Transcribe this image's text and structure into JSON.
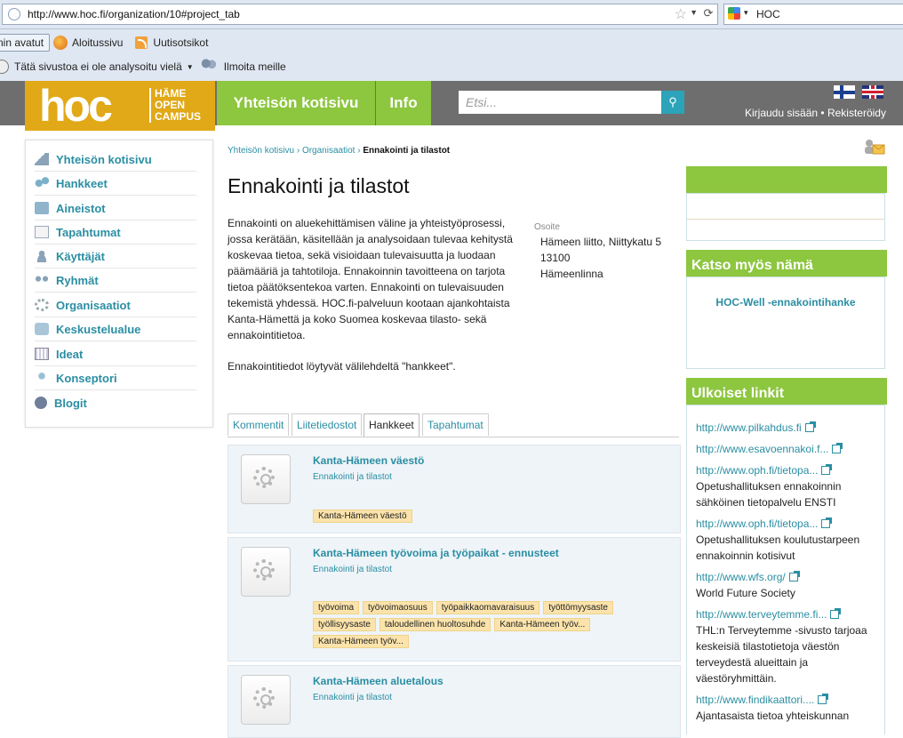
{
  "browser": {
    "url": "http://www.hoc.fi/organization/10#project_tab",
    "search_engine_text": "HOC",
    "bookmarks": [
      "nin avatut",
      "Aloitussivu",
      "Uutisotsikot"
    ],
    "notice": "Tätä sivustoa ei ole analysoitu vielä",
    "report": "Ilmoita meille"
  },
  "header": {
    "logo_text": "hoc",
    "logo_sub": [
      "HÄME",
      "OPEN",
      "CAMPUS"
    ],
    "nav": [
      "Yhteisön kotisivu",
      "Info"
    ],
    "search_placeholder": "Etsi...",
    "login": "Kirjaudu sisään",
    "separator": "•",
    "register": "Rekisteröidy"
  },
  "sidebar": {
    "items": [
      {
        "label": "Yhteisön kotisivu",
        "icon": "home-icon"
      },
      {
        "label": "Hankkeet",
        "icon": "projects-icon"
      },
      {
        "label": "Aineistot",
        "icon": "folder-icon"
      },
      {
        "label": "Tapahtumat",
        "icon": "calendar-icon"
      },
      {
        "label": "Käyttäjät",
        "icon": "user-icon"
      },
      {
        "label": "Ryhmät",
        "icon": "group-icon"
      },
      {
        "label": "Organisaatiot",
        "icon": "gear-icon"
      },
      {
        "label": "Keskustelualue",
        "icon": "chat-icon"
      },
      {
        "label": "Ideat",
        "icon": "keyboard-icon"
      },
      {
        "label": "Konseptori",
        "icon": "bulb-icon"
      },
      {
        "label": "Blogit",
        "icon": "blog-icon"
      }
    ]
  },
  "breadcrumb": {
    "items": [
      "Yhteisön kotisivu",
      "Organisaatiot"
    ],
    "sep": "›",
    "current": "Ennakointi ja tilastot"
  },
  "main": {
    "title": "Ennakointi ja tilastot",
    "description": "Ennakointi on aluekehittämisen väline ja yhteistyöprosessi, jossa kerätään, käsitellään ja analysoidaan tulevaa kehitystä koskevaa tietoa, sekä visioidaan tulevaisuutta ja luodaan päämääriä ja tahtotiloja. Ennakoinnin tavoitteena on tarjota tietoa päätöksentekoa varten. Ennakointi on tulevaisuuden tekemistä yhdessä. HOC.fi-palveluun kootaan ajankohtaista Kanta-Hämettä ja koko Suomea koskevaa tilasto- sekä ennakointitietoa.",
    "description2": "Ennakointitiedot löytyvät välilehdeltä \"hankkeet\".",
    "address_label": "Osoite",
    "address_lines": [
      "Hämeen liitto, Niittykatu 5",
      "13100",
      "Hämeenlinna"
    ]
  },
  "tabs": [
    "Kommentit",
    "Liitetiedostot",
    "Hankkeet",
    "Tapahtumat"
  ],
  "projects": [
    {
      "title": "Kanta-Hämeen väestö",
      "subtitle": "Ennakointi ja tilastot",
      "tags": [
        "Kanta-Hämeen väestö"
      ]
    },
    {
      "title": "Kanta-Hämeen työvoima ja työpaikat - ennusteet",
      "subtitle": "Ennakointi ja tilastot",
      "tags": [
        "työvoima",
        "työvoimaosuus",
        "työpaikkaomavaraisuus",
        "työttömyysaste",
        "työllisyysaste",
        "taloudellinen huoltosuhde",
        "Kanta-Hämeen työv...",
        "Kanta-Hämeen työv..."
      ]
    },
    {
      "title": "Kanta-Hämeen aluetalous",
      "subtitle": "Ennakointi ja tilastot",
      "tags": []
    }
  ],
  "right": {
    "see_also_title": "Katso myös nämä",
    "see_also_link": "HOC-Well -ennakointihanke",
    "external_title": "Ulkoiset linkit",
    "links": [
      {
        "url": "http://www.pilkahdus.fi",
        "desc": ""
      },
      {
        "url": "http://www.esavoennakoi.f...",
        "desc": ""
      },
      {
        "url": "http://www.oph.fi/tietopa...",
        "desc": "Opetushallituksen ennakoinnin sähköinen tietopalvelu ENSTI"
      },
      {
        "url": "http://www.oph.fi/tietopa...",
        "desc": "Opetushallituksen koulutustarpeen ennakoinnin kotisivut"
      },
      {
        "url": "http://www.wfs.org/",
        "desc": "World Future Society"
      },
      {
        "url": "http://www.terveytemme.fi...",
        "desc": "THL:n Terveytemme -sivusto tarjoaa keskeisiä tilastotietoja väestön terveydestä alueittain ja väestöryhmittäin."
      },
      {
        "url": "http://www.findikaattori....",
        "desc": "Ajantasaista tietoa yhteiskunnan"
      }
    ]
  },
  "colors": {
    "green": "#8dc63f",
    "gold": "#e1a817",
    "teal": "#2b8ea3",
    "header_gray": "#6e6e6e"
  }
}
